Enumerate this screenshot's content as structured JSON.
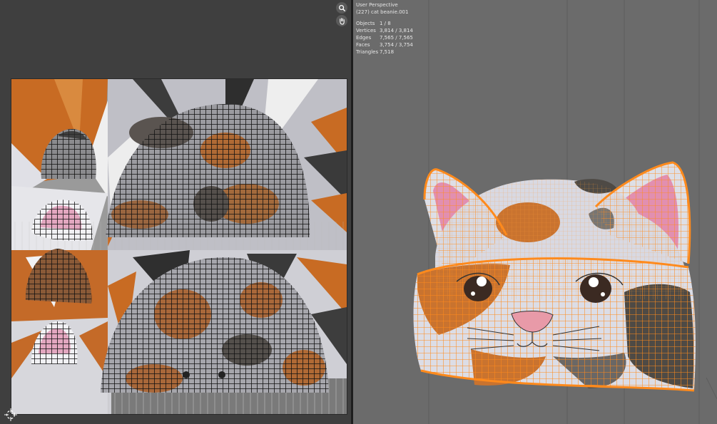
{
  "uv_editor": {
    "zoom_tool_icon": "zoom-icon",
    "pan_tool_icon": "hand-icon"
  },
  "viewport": {
    "view_name": "User Perspective",
    "object_name": "(227) cat beanie.001",
    "stats": [
      {
        "label": "Objects",
        "value": "1 / 8"
      },
      {
        "label": "Vertices",
        "value": "3,814 / 3,814"
      },
      {
        "label": "Edges",
        "value": "7,565 / 7,565"
      },
      {
        "label": "Faces",
        "value": "3,754 / 3,754"
      },
      {
        "label": "Triangles",
        "value": "7,518"
      }
    ]
  },
  "colors": {
    "selection": "#ff8a1c",
    "calico_orange": "#c9732f",
    "calico_dark": "#4e4a45",
    "knit_white": "#dcdde6",
    "ear_pink": "#e28fb0"
  }
}
